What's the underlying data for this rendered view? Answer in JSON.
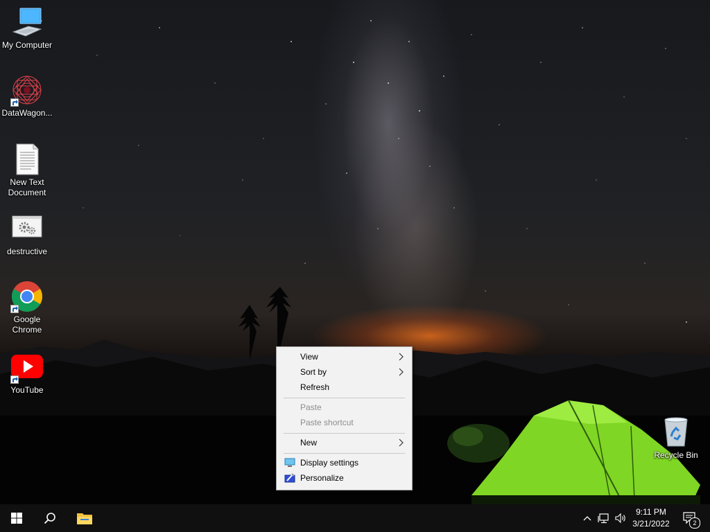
{
  "desktop": {
    "icons": [
      {
        "label": "My Computer",
        "icon": "computer-icon"
      },
      {
        "label": "DataWagon...",
        "icon": "datawagon-app-icon",
        "shortcut": true
      },
      {
        "label": "New Text Document",
        "icon": "text-document-icon"
      },
      {
        "label": "destructive",
        "icon": "script-gear-icon"
      },
      {
        "label": "Google Chrome",
        "icon": "chrome-icon",
        "shortcut": true
      },
      {
        "label": "YouTube",
        "icon": "youtube-icon",
        "shortcut": true
      },
      {
        "label": "Recycle Bin",
        "icon": "recycle-bin-icon"
      }
    ]
  },
  "context_menu": {
    "items": [
      {
        "label": "View",
        "submenu": true,
        "enabled": true
      },
      {
        "label": "Sort by",
        "submenu": true,
        "enabled": true
      },
      {
        "label": "Refresh",
        "enabled": true
      },
      {
        "label": "Paste",
        "enabled": false
      },
      {
        "label": "Paste shortcut",
        "enabled": false
      },
      {
        "label": "New",
        "submenu": true,
        "enabled": true
      },
      {
        "label": "Display settings",
        "icon": "display-settings-icon",
        "enabled": true
      },
      {
        "label": "Personalize",
        "icon": "personalize-icon",
        "enabled": true
      }
    ]
  },
  "taskbar": {
    "start": "windows-start-icon",
    "search": "search-icon",
    "pinned": [
      "file-explorer-icon"
    ],
    "tray_icons": [
      "chevron-up-icon",
      "network-icon",
      "volume-icon"
    ],
    "clock": {
      "time": "9:11 PM",
      "date": "3/21/2022"
    },
    "notifications": {
      "icon": "action-center-icon",
      "count": "2"
    }
  },
  "colors": {
    "menu_bg": "#f2f2f2",
    "menu_disabled_text": "#8d8d8d",
    "taskbar_bg": "#101010",
    "tent_green": "#8be02a"
  }
}
